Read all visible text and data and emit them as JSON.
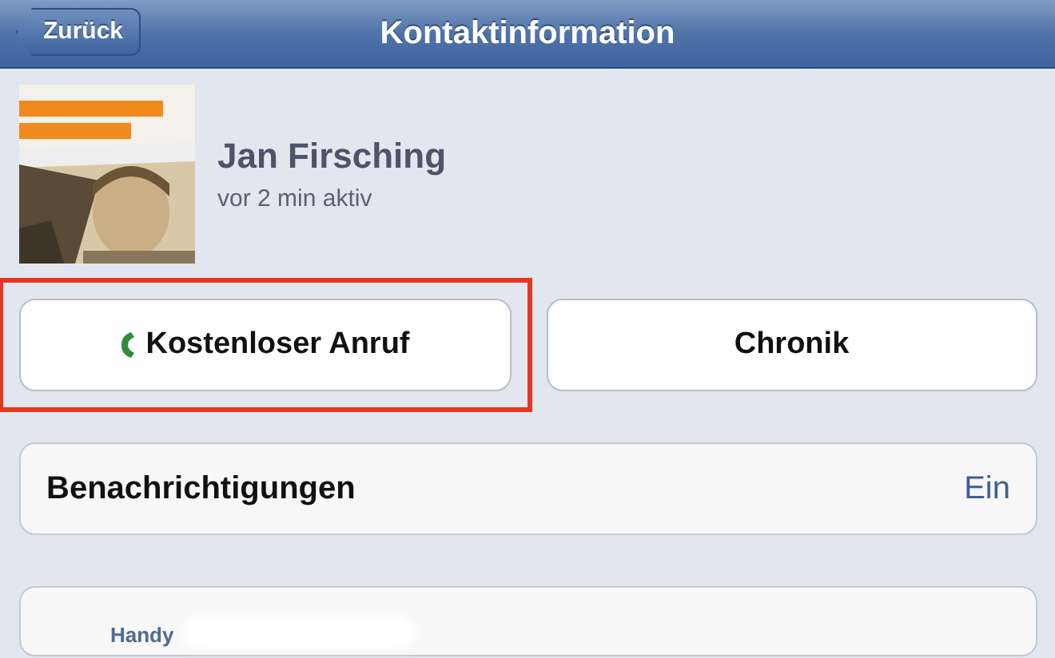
{
  "navbar": {
    "back_button": "Zurück",
    "title": "Kontaktinformation"
  },
  "profile": {
    "name": "Jan Firsching",
    "status": "vor 2 min aktiv"
  },
  "actions": [
    {
      "kind": "call",
      "label": "Kostenloser Anruf",
      "highlighted": true
    },
    {
      "kind": "plain",
      "label": "Chronik"
    }
  ],
  "settings": [
    {
      "label": "Benachrichtigungen",
      "value": "Ein"
    }
  ],
  "phones": [
    {
      "label": "Handy",
      "redacted": true
    }
  ]
}
